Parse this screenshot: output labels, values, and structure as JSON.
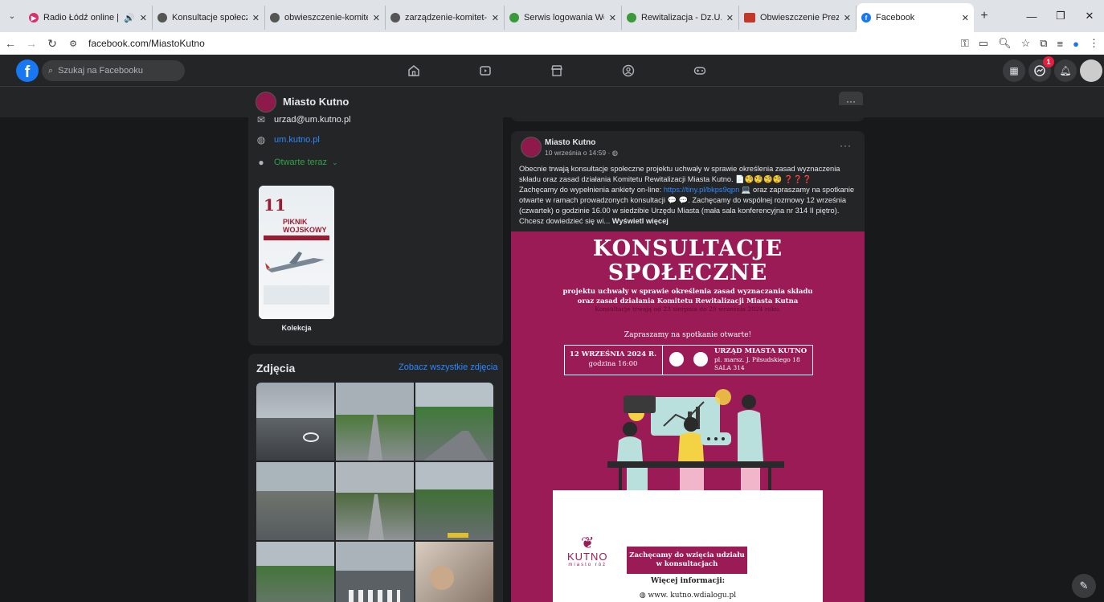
{
  "browser": {
    "tabs": [
      {
        "title": "Radio Łódź online | O",
        "icon": "radio",
        "color": "#d6336c"
      },
      {
        "title": "Konsultacje społeczne",
        "icon": "globe",
        "color": "#555"
      },
      {
        "title": "obwieszczenie-komitet-re",
        "icon": "globe",
        "color": "#555"
      },
      {
        "title": "zarządzenie-komitet-rewi",
        "icon": "globe",
        "color": "#555"
      },
      {
        "title": "Serwis logowania Wolters",
        "icon": "wk",
        "color": "#3a9a3a"
      },
      {
        "title": "Rewitalizacja - Dz.U. i M.P",
        "icon": "wk",
        "color": "#3a9a3a"
      },
      {
        "title": "Obwieszczenie Prezydent",
        "icon": "tvp",
        "color": "#c0392b"
      },
      {
        "title": "Facebook",
        "icon": "facebook",
        "color": "#1877f2"
      }
    ],
    "url": "facebook.com/MiastoKutno"
  },
  "fb": {
    "search_placeholder": "Szukaj na Facebooku",
    "messenger_badge": "1"
  },
  "page": {
    "name": "Miasto Kutno",
    "more": "···"
  },
  "intro": {
    "email": "urzad@um.kutno.pl",
    "website": "um.kutno.pl",
    "hours": "Otwarte teraz"
  },
  "collection": {
    "label": "Kolekcja",
    "thumb_day": "11",
    "thumb_title": "PIKNIK WOJSKOWY"
  },
  "photos": {
    "title": "Zdjęcia",
    "see_all": "Zobacz wszystkie zdjęcia"
  },
  "post": {
    "author": "Miasto Kutno",
    "time": "10 września o 14:59 · ",
    "more": "···",
    "text_1": "Obecnie trwają konsultacje społeczne projektu uchwały w sprawie określenia zasad wyznaczenia składu oraz zasad działania Komitetu Rewitalizacji Miasta Kutno. 📄🧐🧐🧐🧐 ❓❓❓",
    "text_2": "Zachęcamy do wypełnienia ankiety on-line: ",
    "link": "https://tiny.pl/bkps9qpn",
    "text_3": " 💻 oraz zapraszamy na spotkanie otwarte w ramach prowadzonych konsultacji 💬 💬. Zachęcamy do wspólnej rozmowy 12 września (czwartek) o godzinie 16.00 w siedzibie Urzędu Miasta (mała sala konferencyjna nr 314 II piętro). Chcesz dowiedzieć się wi... ",
    "see_more": "Wyświetl więcej"
  },
  "poster": {
    "title_1": "KONSULTACJE",
    "title_2": "SPOŁECZNE",
    "subtitle_1": "projektu uchwały w sprawie określenia zasad wyznaczania składu",
    "subtitle_2": "oraz zasad działania Komitetu Rewitalizacji Miasta Kutna",
    "note": "Konsultacje trwają od 23 sierpnia do 29 września 2024 roku.",
    "invite": "Zapraszamy na spotkanie otwarte!",
    "date": "12 WRZEŚNIA 2024 R.",
    "hour": "godzina 16:00",
    "place_1": "URZĄD MIASTA KUTNO",
    "place_2": "pl. marsz. J. Piłsudskiego 18",
    "place_3": "SALA 314",
    "logo_word": "KUTNO",
    "logo_sub": "miasto róż",
    "cta": "Zachęcamy do wzięcia udziału w konsultacjach",
    "more_info": "Więcej informacji:",
    "website": "www. kutno.wdialogu.pl"
  },
  "colors": {
    "poster_bg": "#9a1b55",
    "fb_blue": "#1877f2",
    "link": "#2d88ff"
  }
}
